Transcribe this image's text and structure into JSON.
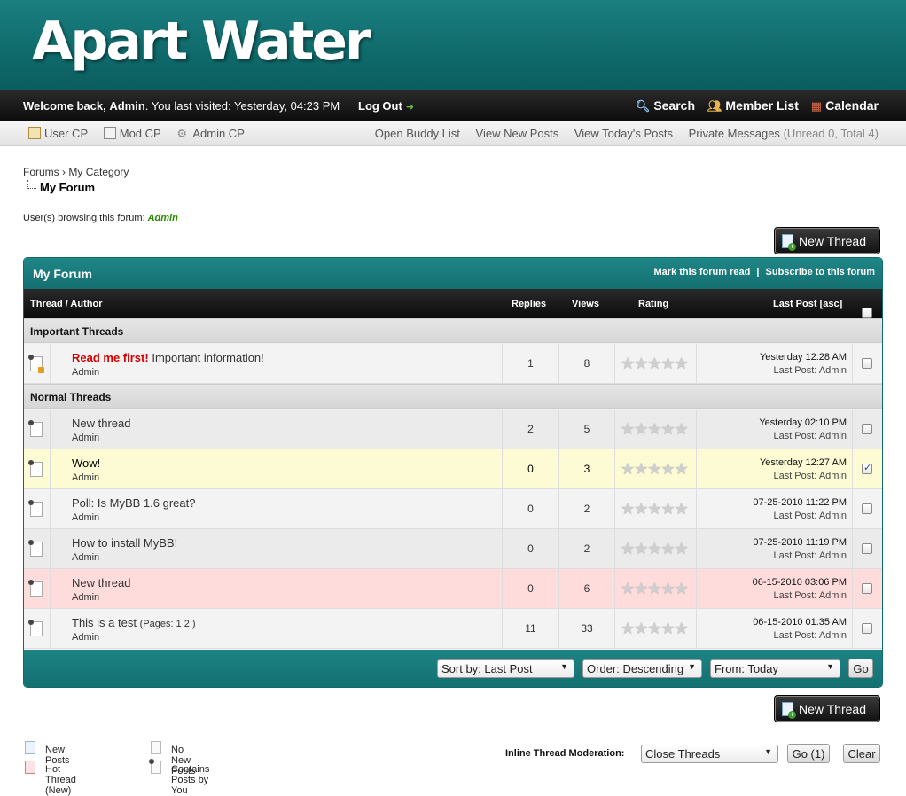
{
  "header": {
    "logo": "Apart Water"
  },
  "topbar": {
    "welcome_prefix": "Welcome back,",
    "username": "Admin",
    "last_visit": ". You last visited: Yesterday, 04:23 PM",
    "logout": "Log Out",
    "nav": {
      "search": "Search",
      "members": "Member List",
      "calendar": "Calendar"
    }
  },
  "subbar": {
    "user_cp": "User CP",
    "mod_cp": "Mod CP",
    "admin_cp": "Admin CP",
    "buddy": "Open Buddy List",
    "new_posts": "View New Posts",
    "today_posts": "View Today's Posts",
    "pm": "Private Messages",
    "pm_counts": "(Unread 0, Total 4)"
  },
  "breadcrumb": {
    "forums": "Forums",
    "sep": "›",
    "category": "My Category",
    "current": "My Forum"
  },
  "browsing": {
    "label": "User(s) browsing this forum:",
    "user": "Admin"
  },
  "buttons": {
    "new_thread": "New Thread"
  },
  "forum": {
    "title": "My Forum",
    "mark_read": "Mark this forum read",
    "divider": "|",
    "subscribe": "Subscribe to this forum",
    "columns": {
      "thread_author": "Thread / Author",
      "replies": "Replies",
      "views": "Views",
      "rating": "Rating",
      "last_post": "Last Post [asc]"
    },
    "important_label": "Important Threads",
    "normal_label": "Normal Threads",
    "important": [
      {
        "prefix": "Read me first!",
        "subject": "Important information!",
        "author": "Admin",
        "replies": "1",
        "views": "8",
        "last_date": "Yesterday 12:28 AM",
        "last_by": "Last Post: Admin",
        "checked": false,
        "stars": "★★★★★"
      }
    ],
    "normal": [
      {
        "subject": "New thread",
        "author": "Admin",
        "replies": "2",
        "views": "5",
        "last_date": "Yesterday 02:10 PM",
        "last_by": "Last Post: Admin",
        "checked": false,
        "stars": "★★★★★"
      },
      {
        "subject": "Wow!",
        "author": "Admin",
        "replies": "0",
        "views": "3",
        "last_date": "Yesterday 12:27 AM",
        "last_by": "Last Post: Admin",
        "checked": true,
        "stars": "★★★★★"
      },
      {
        "subject": "Poll: Is MyBB 1.6 great?",
        "author": "Admin",
        "replies": "0",
        "views": "2",
        "last_date": "07-25-2010 11:22 PM",
        "last_by": "Last Post: Admin",
        "checked": false,
        "stars": "★★★★★"
      },
      {
        "subject": "How to install MyBB!",
        "author": "Admin",
        "replies": "0",
        "views": "2",
        "last_date": "07-25-2010 11:19 PM",
        "last_by": "Last Post: Admin",
        "checked": false,
        "stars": "★★★★★"
      },
      {
        "subject": "New thread",
        "author": "Admin",
        "replies": "0",
        "views": "6",
        "last_date": "06-15-2010 03:06 PM",
        "last_by": "Last Post: Admin",
        "checked": false,
        "stars": "★★★★★"
      },
      {
        "subject": "This is a test",
        "pages": "(Pages: 1 2 )",
        "author": "Admin",
        "replies": "11",
        "views": "33",
        "last_date": "06-15-2010 01:35 AM",
        "last_by": "Last Post: Admin",
        "checked": false,
        "stars": "★★★★★"
      }
    ],
    "footer": {
      "sort": "Sort by: Last Post",
      "order": "Order: Descending",
      "from": "From: Today",
      "go": "Go"
    }
  },
  "legend": {
    "new_posts": "New Posts",
    "hot_thread": "Hot Thread (New)",
    "no_new": "No New Posts",
    "by_you": "Contains Posts by You"
  },
  "inline_mod": {
    "label": "Inline Thread Moderation:",
    "action": "Close Threads",
    "go": "Go (1)",
    "clear": "Clear"
  },
  "colors": {
    "brand_teal": "#136f70",
    "important_prefix": "#d40000",
    "browsing_user": "#2c8a00",
    "row_selected": "#fdfbd4",
    "row_hot": "#ffdcdc"
  }
}
